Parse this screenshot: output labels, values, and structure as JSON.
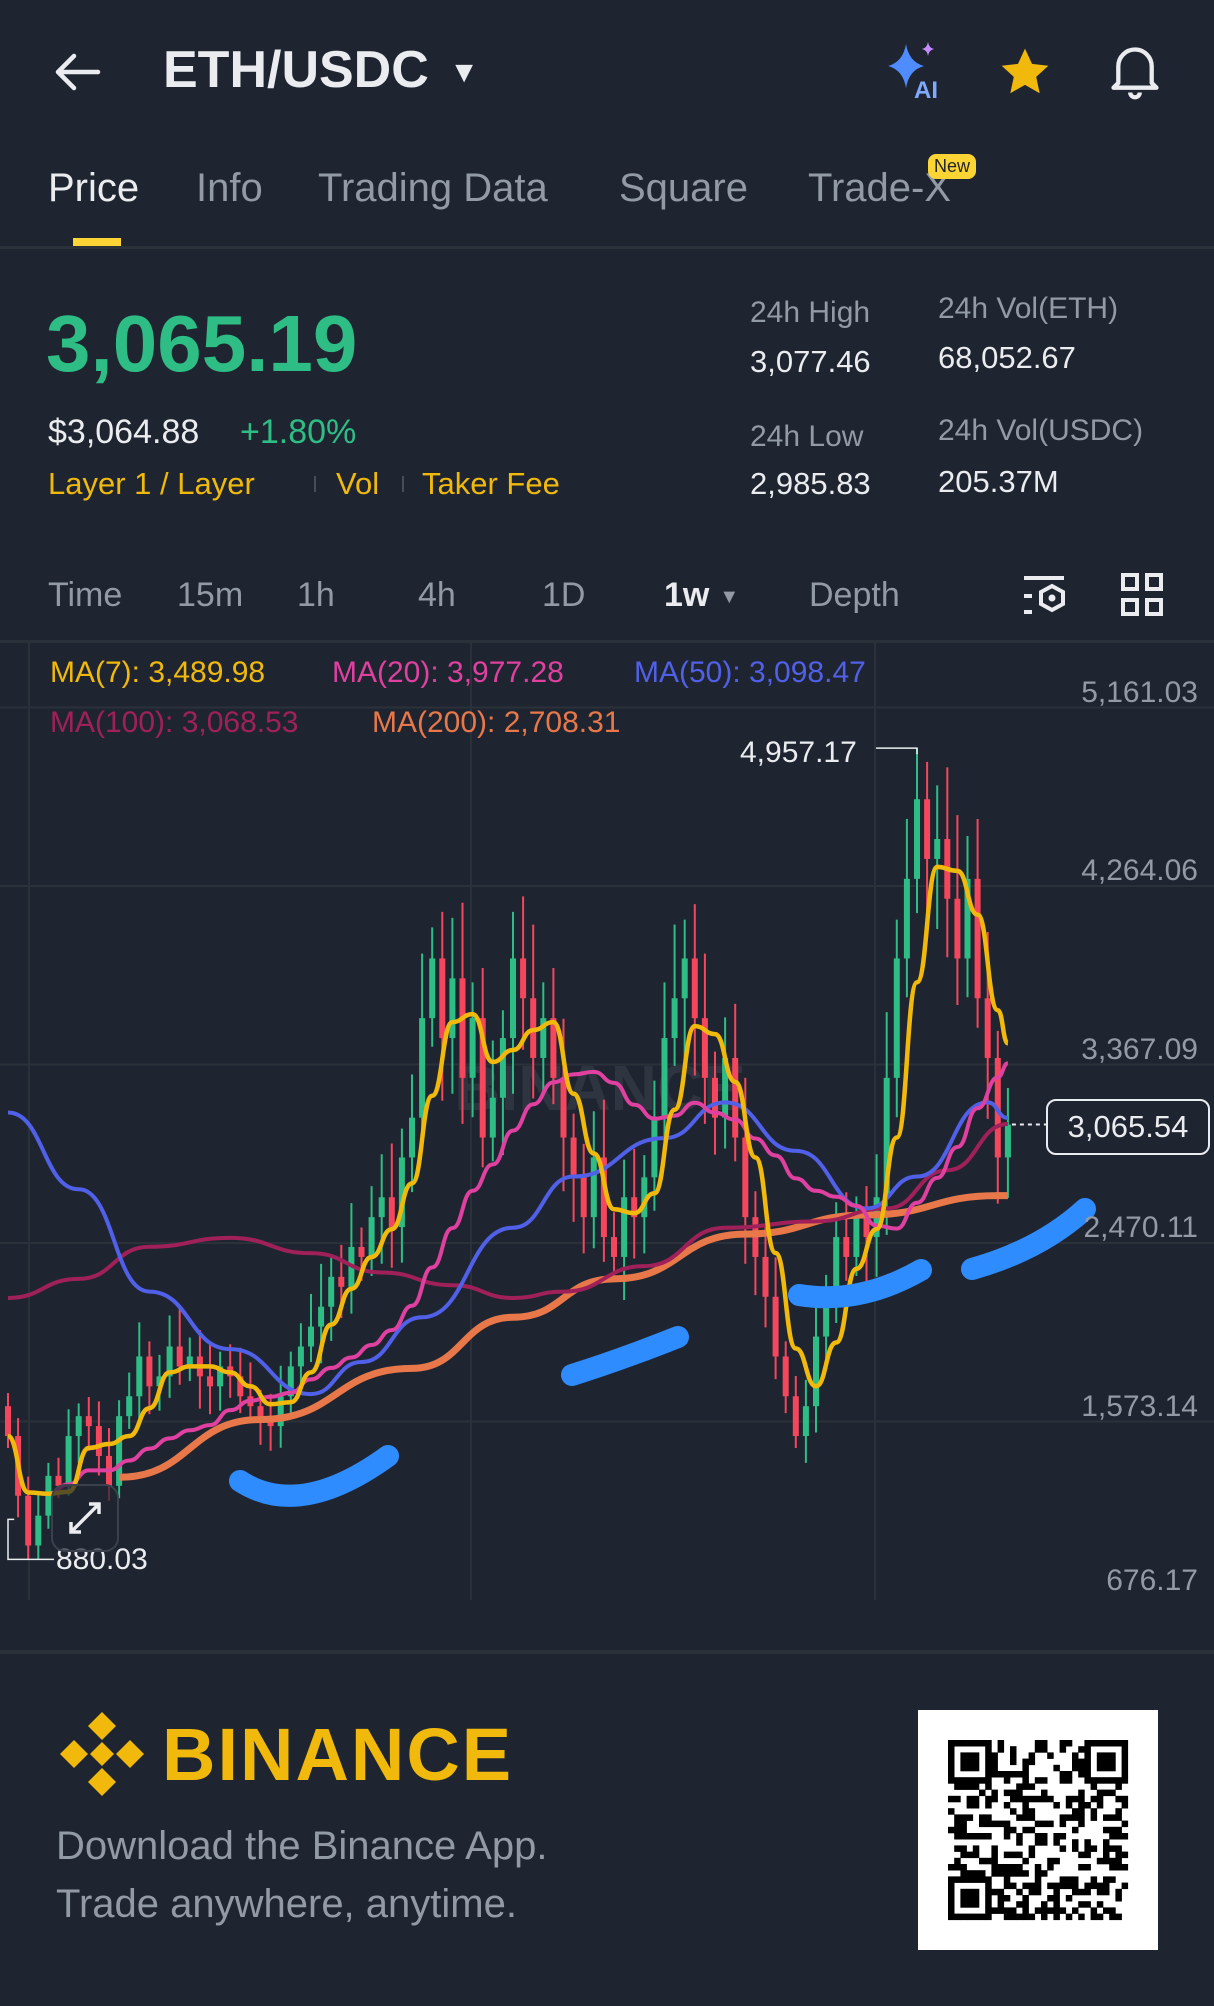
{
  "header": {
    "title": "ETH/USDC",
    "icons": [
      "back-arrow-icon",
      "ai-sparkle-icon",
      "star-icon",
      "bell-icon"
    ],
    "ai_label": "AI"
  },
  "tabs": [
    {
      "label": "Price",
      "active": true
    },
    {
      "label": "Info"
    },
    {
      "label": "Trading Data"
    },
    {
      "label": "Square"
    },
    {
      "label": "Trade-X",
      "badge": "New"
    }
  ],
  "ticker": {
    "last_price": "3,065.19",
    "usd_price": "$3,064.88",
    "change": "+1.80%",
    "tags": [
      "Layer 1 / Layer",
      "Vol",
      "Taker Fee"
    ],
    "stats": [
      {
        "label": "24h High",
        "value": "3,077.46"
      },
      {
        "label": "24h Vol(ETH)",
        "value": "68,052.67"
      },
      {
        "label": "24h Low",
        "value": "2,985.83"
      },
      {
        "label": "24h Vol(USDC)",
        "value": "205.37M"
      }
    ]
  },
  "timeframes": {
    "items": [
      "Time",
      "15m",
      "1h",
      "4h",
      "1D",
      "1w",
      "Depth"
    ],
    "active": "1w"
  },
  "colors": {
    "up": "#2ebd85",
    "down": "#f6465d",
    "accent": "#f0b90b",
    "ma7": "#f0b90b",
    "ma20": "#e040a0",
    "ma50": "#5060e8",
    "ma100": "#a0205a",
    "ma200": "#e8784a",
    "annotation": "#2f8cff"
  },
  "chart_data": {
    "type": "candlestick",
    "interval": "1w",
    "legend": [
      {
        "name": "MA(7)",
        "value": "3,489.98"
      },
      {
        "name": "MA(20)",
        "value": "3,977.28"
      },
      {
        "name": "MA(50)",
        "value": "3,098.47"
      },
      {
        "name": "MA(100)",
        "value": "3,068.53"
      },
      {
        "name": "MA(200)",
        "value": "2,708.31"
      }
    ],
    "y_ticks": [
      "5,161.03",
      "4,264.06",
      "3,367.09",
      "2,470.11",
      "1,573.14",
      "676.17"
    ],
    "y_tick_values": [
      5161.03,
      4264.06,
      3367.09,
      2470.11,
      1573.14,
      676.17
    ],
    "ylim": [
      676.17,
      5161.03
    ],
    "high_marker": {
      "label": "4,957.17",
      "value": 4957.17,
      "index": 90
    },
    "low_marker": {
      "label": "880.03",
      "value": 880.03,
      "index": 2
    },
    "current_price": {
      "label": "3,065.54",
      "value": 3065.54
    },
    "watermark": "BINANCE",
    "closes": [
      1500,
      1200,
      950,
      1100,
      1300,
      1250,
      1500,
      1600,
      1550,
      1400,
      1250,
      1600,
      1700,
      1900,
      1750,
      1800,
      1950,
      1850,
      1900,
      1800,
      1750,
      1850,
      1800,
      1700,
      1650,
      1600,
      1550,
      1700,
      1850,
      1950,
      2050,
      2150,
      2300,
      2250,
      2450,
      2400,
      2600,
      2700,
      2550,
      2900,
      3100,
      3600,
      3900,
      3500,
      3800,
      3300,
      3600,
      3000,
      3200,
      3500,
      3900,
      3700,
      3400,
      3600,
      3300,
      3000,
      2800,
      2600,
      2900,
      2500,
      2400,
      2700,
      2600,
      2800,
      3100,
      3500,
      3700,
      3900,
      3600,
      3300,
      3100,
      3400,
      3000,
      2600,
      2400,
      2200,
      1900,
      1700,
      1500,
      1650,
      2000,
      2200,
      2500,
      2400,
      2600,
      2500,
      2700,
      3300,
      3900,
      4300,
      4700,
      4400,
      4500,
      4200,
      3900,
      4300,
      3700,
      3400,
      2900,
      3065
    ],
    "ma50": [
      [
        0,
        3126
      ],
      [
        7,
        2740
      ],
      [
        14,
        2226
      ],
      [
        22,
        1937
      ],
      [
        30,
        1711
      ],
      [
        35,
        1872
      ],
      [
        41,
        2097
      ],
      [
        50,
        2547
      ],
      [
        56,
        2804
      ],
      [
        65,
        2997
      ],
      [
        71,
        3177
      ],
      [
        78,
        2933
      ],
      [
        85,
        2644
      ],
      [
        90,
        2804
      ],
      [
        97,
        3177
      ],
      [
        99,
        3098
      ]
    ],
    "ma100": [
      [
        0,
        2194
      ],
      [
        7,
        2290
      ],
      [
        14,
        2451
      ],
      [
        22,
        2496
      ],
      [
        30,
        2419
      ],
      [
        37,
        2322
      ],
      [
        44,
        2258
      ],
      [
        50,
        2194
      ],
      [
        55,
        2226
      ],
      [
        63,
        2354
      ],
      [
        71,
        2547
      ],
      [
        80,
        2579
      ],
      [
        87,
        2644
      ],
      [
        93,
        2836
      ],
      [
        99,
        3068
      ]
    ],
    "ma200": [
      [
        11,
        1293
      ],
      [
        25,
        1583
      ],
      [
        40,
        1840
      ],
      [
        50,
        2097
      ],
      [
        60,
        2290
      ],
      [
        73,
        2515
      ],
      [
        85,
        2611
      ],
      [
        98,
        2708
      ],
      [
        99,
        2708
      ]
    ]
  },
  "footer": {
    "brand": "BINANCE",
    "line1": "Download the Binance App.",
    "line2": "Trade anywhere, anytime."
  }
}
